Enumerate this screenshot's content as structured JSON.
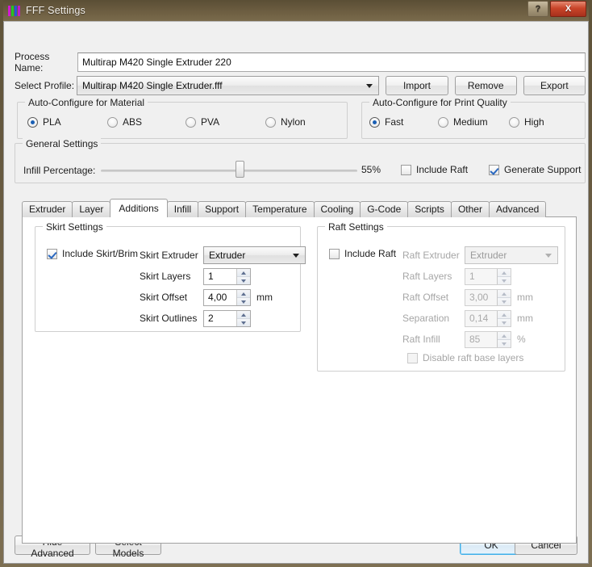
{
  "window": {
    "title": "FFF Settings",
    "icon": "fff-logo-icon",
    "help_label": "?",
    "close_label": "X"
  },
  "form": {
    "process_name_label": "Process Name:",
    "process_name_value": "Multirap M420 Single Extruder 220",
    "select_profile_label": "Select Profile:",
    "select_profile_value": "Multirap M420 Single Extruder.fff",
    "import_label": "Import",
    "remove_label": "Remove",
    "export_label": "Export"
  },
  "material": {
    "caption": "Auto-Configure for Material",
    "options": [
      {
        "label": "PLA",
        "selected": true
      },
      {
        "label": "ABS",
        "selected": false
      },
      {
        "label": "PVA",
        "selected": false
      },
      {
        "label": "Nylon",
        "selected": false
      }
    ]
  },
  "quality": {
    "caption": "Auto-Configure for Print Quality",
    "options": [
      {
        "label": "Fast",
        "selected": true
      },
      {
        "label": "Medium",
        "selected": false
      },
      {
        "label": "High",
        "selected": false
      }
    ]
  },
  "general": {
    "caption": "General Settings",
    "infill_label": "Infill Percentage:",
    "infill_value": "55%",
    "infill_percent": 55,
    "include_raft_label": "Include Raft",
    "include_raft_checked": false,
    "generate_support_label": "Generate Support",
    "generate_support_checked": true
  },
  "tabs": [
    {
      "label": "Extruder",
      "active": false
    },
    {
      "label": "Layer",
      "active": false
    },
    {
      "label": "Additions",
      "active": true
    },
    {
      "label": "Infill",
      "active": false
    },
    {
      "label": "Support",
      "active": false
    },
    {
      "label": "Temperature",
      "active": false
    },
    {
      "label": "Cooling",
      "active": false
    },
    {
      "label": "G-Code",
      "active": false
    },
    {
      "label": "Scripts",
      "active": false
    },
    {
      "label": "Other",
      "active": false
    },
    {
      "label": "Advanced",
      "active": false
    }
  ],
  "skirt": {
    "caption": "Skirt Settings",
    "include_label": "Include Skirt/Brim",
    "include_checked": true,
    "extruder_label": "Skirt Extruder",
    "extruder_value": "Extruder",
    "layers_label": "Skirt Layers",
    "layers_value": "1",
    "offset_label": "Skirt Offset",
    "offset_value": "4,00",
    "offset_unit": "mm",
    "outlines_label": "Skirt Outlines",
    "outlines_value": "2"
  },
  "raft": {
    "caption": "Raft Settings",
    "include_label": "Include Raft",
    "include_checked": false,
    "extruder_label": "Raft Extruder",
    "extruder_value": "Extruder",
    "layers_label": "Raft Layers",
    "layers_value": "1",
    "offset_label": "Raft Offset",
    "offset_value": "3,00",
    "offset_unit": "mm",
    "separation_label": "Separation",
    "separation_value": "0,14",
    "separation_unit": "mm",
    "infill_label": "Raft Infill",
    "infill_value": "85",
    "infill_unit": "%",
    "disable_base_label": "Disable raft base layers",
    "disable_base_checked": false
  },
  "footer": {
    "hide_advanced_label": "Hide Advanced",
    "select_models_label": "Select Models",
    "ok_label": "OK",
    "cancel_label": "Cancel"
  },
  "colors": {
    "accent": "#1a5fb4",
    "check": "#2a68c0",
    "titlebar": "#6b5c40",
    "close": "#c9452a",
    "focus_ring": "#3faee8"
  }
}
